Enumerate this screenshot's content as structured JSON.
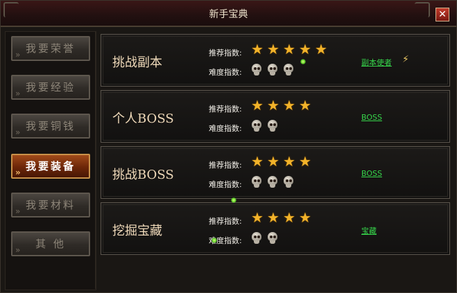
{
  "window": {
    "title": "新手宝典",
    "close_label": "✕"
  },
  "sidebar": {
    "items": [
      {
        "label": "我要荣誉",
        "active": false
      },
      {
        "label": "我要经验",
        "active": false
      },
      {
        "label": "我要铜钱",
        "active": false
      },
      {
        "label": "我要装备",
        "active": true
      },
      {
        "label": "我要材料",
        "active": false
      },
      {
        "label": "其 他",
        "active": false
      }
    ]
  },
  "labels": {
    "recommend": "推荐指数:",
    "difficulty": "难度指数:"
  },
  "cards": [
    {
      "title": "挑战副本",
      "recommend_stars": 5,
      "difficulty_skulls": 3,
      "link": "副本使者",
      "has_npc_icon": true
    },
    {
      "title": "个人BOSS",
      "recommend_stars": 4,
      "difficulty_skulls": 2,
      "link": "BOSS",
      "has_npc_icon": false
    },
    {
      "title": "挑战BOSS",
      "recommend_stars": 4,
      "difficulty_skulls": 3,
      "link": "BOSS",
      "has_npc_icon": false
    },
    {
      "title": "挖掘宝藏",
      "recommend_stars": 4,
      "difficulty_skulls": 2,
      "link": "宝藏",
      "has_npc_icon": false
    }
  ],
  "icons": {
    "star": "★",
    "npc": "⚡",
    "chevron": "»"
  },
  "colors": {
    "accent": "#c99149",
    "link": "#36d44a",
    "star": "#f2b32a"
  }
}
